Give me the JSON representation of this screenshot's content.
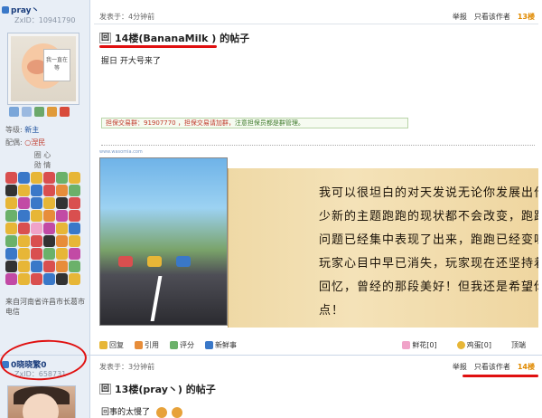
{
  "post1": {
    "user": {
      "name": "pray丶",
      "zxid": "ZxID：10941790"
    },
    "avatar_sign": "我一直在等",
    "profile": {
      "title_label": "等级:",
      "title_value": "新主",
      "spouse_label": "配偶:",
      "spouse_value": "○涅民",
      "watch_label": "圈  心\n勋  情"
    },
    "location": "来自河南省许昌市长葛市电信",
    "meta": {
      "posted": "发表于：4分钟前",
      "report": "举报",
      "author_only": "只看该作者",
      "floor": "13楼"
    },
    "title": "14楼(BananaMilk   ) 的帖子",
    "reply_marker": "回",
    "body": "握日 开大号来了",
    "guarantee": {
      "prefix": "担保交易群：91907770 ，担保交易请加群，",
      "suffix": "注意担保员都是群管理。"
    },
    "url_tag": "www.wasomia.com",
    "scroll_lines": [
      "我可以很坦白的对天发说无论你发展出什么",
      "少新的主题跑跑的现状都不会改变，跑跑多年",
      "问题已经集中表现了出来，跑跑已经变味了，",
      "玩家心目中早已消失，玩家现在还坚持着只",
      "回忆，曾经的那段美好！但我还是希望你能",
      "点！"
    ],
    "actions": {
      "reply": "回复",
      "quote": "引用",
      "rate": "评分",
      "fresh": "新鲜事"
    },
    "actions_right": {
      "flower": "鲜花[0]",
      "egg": "鸡蛋[0]",
      "top": "顶端"
    }
  },
  "post2": {
    "user": {
      "name": "0晓晓繁0",
      "zxid": "ZxID：658731"
    },
    "meta": {
      "posted": "发表于：3分钟前",
      "report": "举报",
      "author_only": "只看该作者",
      "floor": "14楼"
    },
    "title": "13楼(pray丶) 的帖子",
    "reply_marker": "回",
    "body": "回事的太慢了"
  },
  "colors": {
    "accent_red": "#e01010",
    "floor_orange": "#e08a00",
    "link_blue": "#1b4f9c"
  }
}
